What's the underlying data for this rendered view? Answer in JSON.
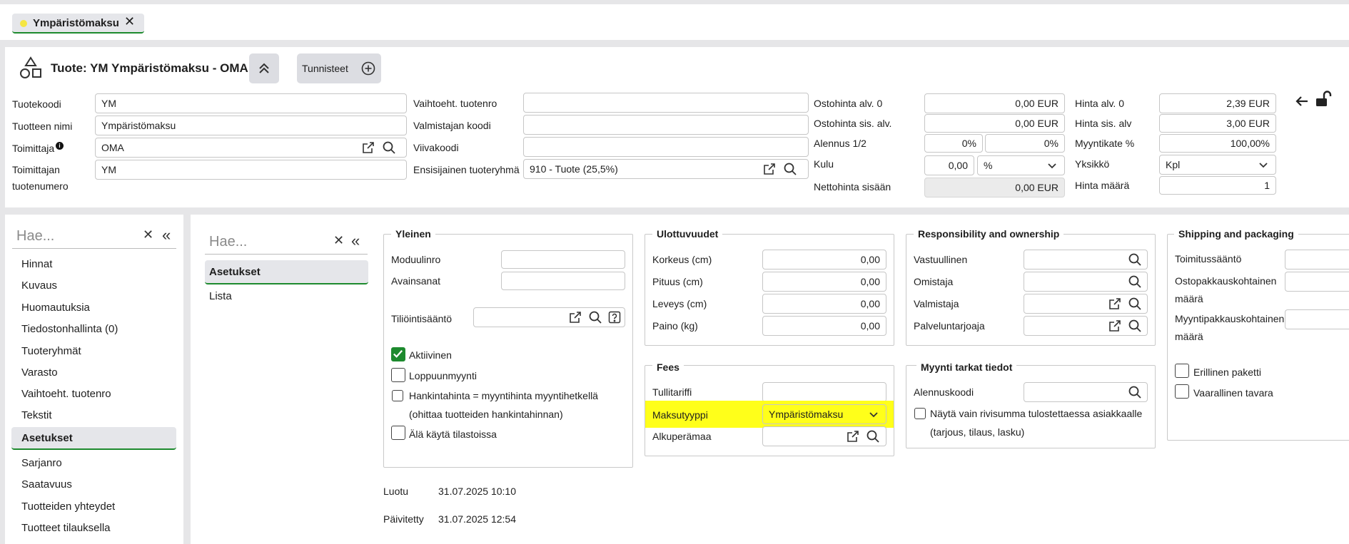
{
  "tab": {
    "label": "Ympäristömaksu",
    "dot_color": "#f5e642",
    "accent": "#1d8a2e"
  },
  "header": {
    "title": "Tuote: YM Ympäristömaksu - OMA",
    "tags_button": "Tunnisteet"
  },
  "form": {
    "tuotekoodi_label": "Tuotekoodi",
    "tuotekoodi": "YM",
    "tuotteen_nimi_label": "Tuotteen nimi",
    "tuotteen_nimi": "Ympäristömaksu",
    "toimittaja_label": "Toimittaja",
    "toimittaja": "OMA",
    "toimittajan_label_1": "Toimittajan",
    "toimittajan_label_2": "tuotenumero",
    "toimittajan_tuotenumero": "YM",
    "vaihtoeht_label": "Vaihtoeht. tuotenro",
    "vaihtoeht": "",
    "valmistajan_label": "Valmistajan koodi",
    "valmistajan": "",
    "viivakoodi_label": "Viivakoodi",
    "viivakoodi": "",
    "ensisijainen_label": "Ensisijainen tuoteryhmä",
    "ensisijainen": "910 - Tuote (25,5%)"
  },
  "prices": {
    "ostohinta_alv0_label": "Ostohinta alv. 0",
    "ostohinta_alv0": "0,00",
    "currency": "EUR",
    "ostohinta_sis_label": "Ostohinta sis. alv.",
    "ostohinta_sis": "0,00",
    "alennus_label": "Alennus 1/2",
    "alennus1": "0%",
    "alennus2": "0%",
    "kulu_label": "Kulu",
    "kulu": "0,00",
    "kulu_unit": "%",
    "nettohinta_label": "Nettohinta sisään",
    "nettohinta": "0,00 EUR",
    "hinta_alv0_label": "Hinta alv. 0",
    "hinta_alv0": "2,39 EUR",
    "hinta_sis_label": "Hinta sis. alv",
    "hinta_sis": "3,00 EUR",
    "myyntikate_label": "Myyntikate %",
    "myyntikate": "100,00%",
    "yksikko_label": "Yksikkö",
    "yksikko": "Kpl",
    "hinta_maara_label": "Hinta määrä",
    "hinta_maara": "1"
  },
  "sidebar": {
    "search_placeholder": "Hae...",
    "items": [
      "Hinnat",
      "Kuvaus",
      "Huomautuksia",
      "Tiedostonhallinta (0)",
      "Tuoteryhmät",
      "Varasto",
      "Vaihtoeht. tuotenro",
      "Tekstit",
      "Asetukset",
      "Sarjanro",
      "Saatavuus",
      "Tuotteiden yhteydet",
      "Tuotteet tilauksella"
    ]
  },
  "subnav": {
    "search_placeholder": "Hae...",
    "items": [
      "Asetukset",
      "Lista"
    ]
  },
  "yleinen": {
    "title": "Yleinen",
    "moduulinro_label": "Moduulinro",
    "avainsanat_label": "Avainsanat",
    "tiliointi_label": "Tiliöintisääntö",
    "aktiivinen": "Aktiivinen",
    "loppuunmyynti": "Loppuunmyynti",
    "hankintahinta_1": "Hankintahinta = myyntihinta myyntihetkellä",
    "hankintahinta_2": "(ohittaa tuotteiden hankintahinnan)",
    "ala_kayta": "Älä käytä tilastoissa"
  },
  "ulottuvuudet": {
    "title": "Ulottuvuudet",
    "korkeus_label": "Korkeus (cm)",
    "korkeus": "0,00",
    "pituus_label": "Pituus (cm)",
    "pituus": "0,00",
    "leveys_label": "Leveys (cm)",
    "leveys": "0,00",
    "paino_label": "Paino (kg)",
    "paino": "0,00"
  },
  "fees": {
    "title": "Fees",
    "tullitariffi_label": "Tullitariffi",
    "maksutyyppi_label": "Maksutyyppi",
    "maksutyyppi": "Ympäristömaksu",
    "highlight_color": "#ffff1a",
    "alkuperamaa_label": "Alkuperämaa"
  },
  "responsibility": {
    "title": "Responsibility and ownership",
    "vastuullinen": "Vastuullinen",
    "omistaja": "Omistaja",
    "valmistaja": "Valmistaja",
    "palveluntarjoaja": "Palveluntarjoaja"
  },
  "myynti": {
    "title": "Myynti tarkat tiedot",
    "alennuskoodi": "Alennuskoodi",
    "nayta_1": "Näytä vain rivisumma tulostettaessa asiakkaalle",
    "nayta_2": "(tarjous, tilaus, lasku)"
  },
  "shipping": {
    "title": "Shipping and packaging",
    "toimitussaanto": "Toimitussääntö",
    "ostopakkaus_1": "Ostopakkauskohtainen",
    "ostopakkaus_2": "määrä",
    "myyntipakkaus_1": "Myyntipakkauskohtainen",
    "myyntipakkaus_2": "määrä",
    "erillinen": "Erillinen paketti",
    "vaarallinen": "Vaarallinen tavara"
  },
  "meta": {
    "luotu_label": "Luotu",
    "luotu": "31.07.2025 10:10",
    "paivitetty_label": "Päivitetty",
    "paivitetty": "31.07.2025 12:54"
  }
}
